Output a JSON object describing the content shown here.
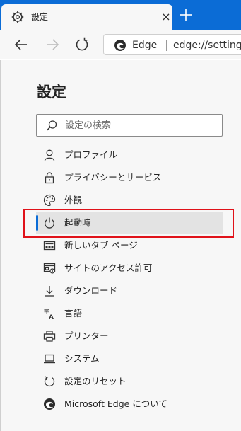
{
  "tab": {
    "title": "設定",
    "close_glyph": "×",
    "gear_icon": "gear-icon"
  },
  "new_tab_icon": "plus-icon",
  "toolbar": {
    "back_icon": "back-arrow-icon",
    "forward_icon": "forward-arrow-icon",
    "refresh_icon": "refresh-icon",
    "address": {
      "brand": "Edge",
      "url": "edge://settings"
    }
  },
  "page": {
    "title": "設定",
    "search_placeholder": "設定の検索"
  },
  "sidebar": {
    "items": [
      {
        "label": "プロファイル",
        "icon": "person-icon"
      },
      {
        "label": "プライバシーとサービス",
        "icon": "lock-icon"
      },
      {
        "label": "外観",
        "icon": "palette-icon"
      },
      {
        "label": "起動時",
        "icon": "power-icon",
        "active": true
      },
      {
        "label": "新しいタブ ページ",
        "icon": "new-tab-page-icon"
      },
      {
        "label": "サイトのアクセス許可",
        "icon": "site-permissions-icon"
      },
      {
        "label": "ダウンロード",
        "icon": "download-icon"
      },
      {
        "label": "言語",
        "icon": "language-icon"
      },
      {
        "label": "プリンター",
        "icon": "printer-icon"
      },
      {
        "label": "システム",
        "icon": "laptop-icon"
      },
      {
        "label": "設定のリセット",
        "icon": "reset-icon"
      },
      {
        "label": "Microsoft Edge について",
        "icon": "edge-logo-icon"
      }
    ]
  },
  "colors": {
    "accent": "#0b6cd6",
    "highlight": "#e0121a",
    "panel": "#f7f7f7"
  }
}
